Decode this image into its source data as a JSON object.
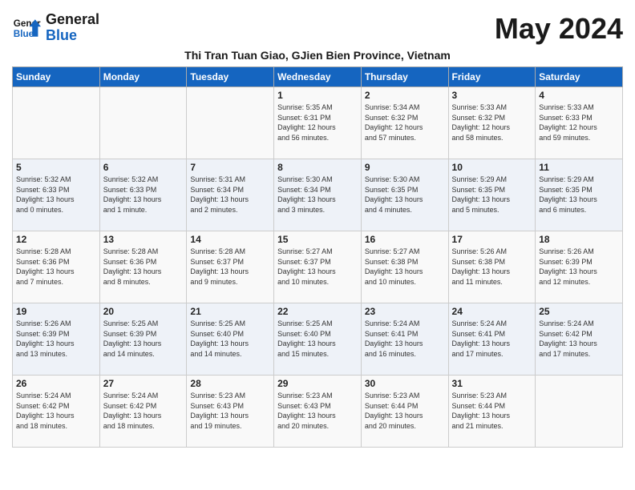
{
  "header": {
    "logo_line1": "General",
    "logo_line2": "Blue",
    "month_year": "May 2024",
    "subtitle": "Thi Tran Tuan Giao, GJien Bien Province, Vietnam"
  },
  "weekdays": [
    "Sunday",
    "Monday",
    "Tuesday",
    "Wednesday",
    "Thursday",
    "Friday",
    "Saturday"
  ],
  "weeks": [
    [
      {
        "day": "",
        "info": ""
      },
      {
        "day": "",
        "info": ""
      },
      {
        "day": "",
        "info": ""
      },
      {
        "day": "1",
        "info": "Sunrise: 5:35 AM\nSunset: 6:31 PM\nDaylight: 12 hours\nand 56 minutes."
      },
      {
        "day": "2",
        "info": "Sunrise: 5:34 AM\nSunset: 6:32 PM\nDaylight: 12 hours\nand 57 minutes."
      },
      {
        "day": "3",
        "info": "Sunrise: 5:33 AM\nSunset: 6:32 PM\nDaylight: 12 hours\nand 58 minutes."
      },
      {
        "day": "4",
        "info": "Sunrise: 5:33 AM\nSunset: 6:33 PM\nDaylight: 12 hours\nand 59 minutes."
      }
    ],
    [
      {
        "day": "5",
        "info": "Sunrise: 5:32 AM\nSunset: 6:33 PM\nDaylight: 13 hours\nand 0 minutes."
      },
      {
        "day": "6",
        "info": "Sunrise: 5:32 AM\nSunset: 6:33 PM\nDaylight: 13 hours\nand 1 minute."
      },
      {
        "day": "7",
        "info": "Sunrise: 5:31 AM\nSunset: 6:34 PM\nDaylight: 13 hours\nand 2 minutes."
      },
      {
        "day": "8",
        "info": "Sunrise: 5:30 AM\nSunset: 6:34 PM\nDaylight: 13 hours\nand 3 minutes."
      },
      {
        "day": "9",
        "info": "Sunrise: 5:30 AM\nSunset: 6:35 PM\nDaylight: 13 hours\nand 4 minutes."
      },
      {
        "day": "10",
        "info": "Sunrise: 5:29 AM\nSunset: 6:35 PM\nDaylight: 13 hours\nand 5 minutes."
      },
      {
        "day": "11",
        "info": "Sunrise: 5:29 AM\nSunset: 6:35 PM\nDaylight: 13 hours\nand 6 minutes."
      }
    ],
    [
      {
        "day": "12",
        "info": "Sunrise: 5:28 AM\nSunset: 6:36 PM\nDaylight: 13 hours\nand 7 minutes."
      },
      {
        "day": "13",
        "info": "Sunrise: 5:28 AM\nSunset: 6:36 PM\nDaylight: 13 hours\nand 8 minutes."
      },
      {
        "day": "14",
        "info": "Sunrise: 5:28 AM\nSunset: 6:37 PM\nDaylight: 13 hours\nand 9 minutes."
      },
      {
        "day": "15",
        "info": "Sunrise: 5:27 AM\nSunset: 6:37 PM\nDaylight: 13 hours\nand 10 minutes."
      },
      {
        "day": "16",
        "info": "Sunrise: 5:27 AM\nSunset: 6:38 PM\nDaylight: 13 hours\nand 10 minutes."
      },
      {
        "day": "17",
        "info": "Sunrise: 5:26 AM\nSunset: 6:38 PM\nDaylight: 13 hours\nand 11 minutes."
      },
      {
        "day": "18",
        "info": "Sunrise: 5:26 AM\nSunset: 6:39 PM\nDaylight: 13 hours\nand 12 minutes."
      }
    ],
    [
      {
        "day": "19",
        "info": "Sunrise: 5:26 AM\nSunset: 6:39 PM\nDaylight: 13 hours\nand 13 minutes."
      },
      {
        "day": "20",
        "info": "Sunrise: 5:25 AM\nSunset: 6:39 PM\nDaylight: 13 hours\nand 14 minutes."
      },
      {
        "day": "21",
        "info": "Sunrise: 5:25 AM\nSunset: 6:40 PM\nDaylight: 13 hours\nand 14 minutes."
      },
      {
        "day": "22",
        "info": "Sunrise: 5:25 AM\nSunset: 6:40 PM\nDaylight: 13 hours\nand 15 minutes."
      },
      {
        "day": "23",
        "info": "Sunrise: 5:24 AM\nSunset: 6:41 PM\nDaylight: 13 hours\nand 16 minutes."
      },
      {
        "day": "24",
        "info": "Sunrise: 5:24 AM\nSunset: 6:41 PM\nDaylight: 13 hours\nand 17 minutes."
      },
      {
        "day": "25",
        "info": "Sunrise: 5:24 AM\nSunset: 6:42 PM\nDaylight: 13 hours\nand 17 minutes."
      }
    ],
    [
      {
        "day": "26",
        "info": "Sunrise: 5:24 AM\nSunset: 6:42 PM\nDaylight: 13 hours\nand 18 minutes."
      },
      {
        "day": "27",
        "info": "Sunrise: 5:24 AM\nSunset: 6:42 PM\nDaylight: 13 hours\nand 18 minutes."
      },
      {
        "day": "28",
        "info": "Sunrise: 5:23 AM\nSunset: 6:43 PM\nDaylight: 13 hours\nand 19 minutes."
      },
      {
        "day": "29",
        "info": "Sunrise: 5:23 AM\nSunset: 6:43 PM\nDaylight: 13 hours\nand 20 minutes."
      },
      {
        "day": "30",
        "info": "Sunrise: 5:23 AM\nSunset: 6:44 PM\nDaylight: 13 hours\nand 20 minutes."
      },
      {
        "day": "31",
        "info": "Sunrise: 5:23 AM\nSunset: 6:44 PM\nDaylight: 13 hours\nand 21 minutes."
      },
      {
        "day": "",
        "info": ""
      }
    ]
  ]
}
